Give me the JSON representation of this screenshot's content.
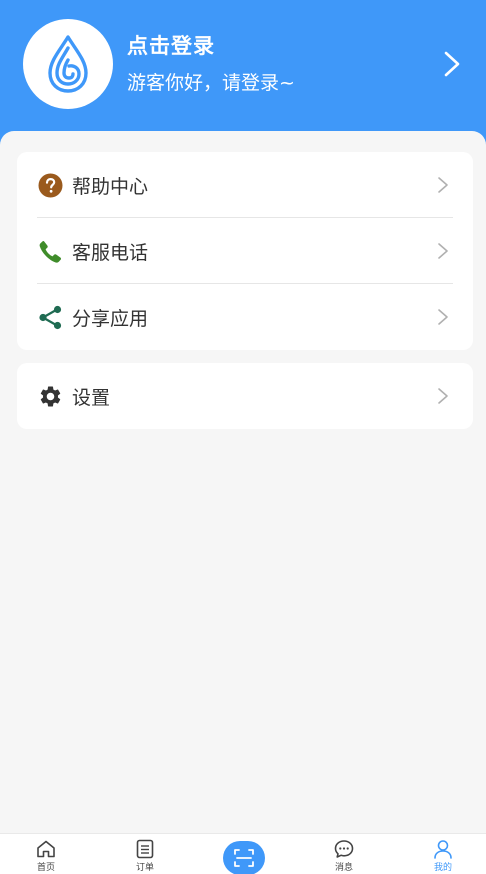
{
  "colors": {
    "accent": "#3f98f9",
    "help_icon": "#9a5a1d",
    "phone_icon": "#3f8c2a",
    "share_icon": "#1f6b52",
    "gear_icon": "#333333"
  },
  "header": {
    "title": "点击登录",
    "subtitle": "游客你好，请登录~",
    "logo_icon": "water-drop-logo",
    "chevron_icon": "chevron-right-icon"
  },
  "menu_group_1": [
    {
      "label": "帮助中心",
      "icon": "help-icon"
    },
    {
      "label": "客服电话",
      "icon": "phone-icon"
    },
    {
      "label": "分享应用",
      "icon": "share-icon"
    }
  ],
  "menu_group_2": [
    {
      "label": "设置",
      "icon": "gear-icon"
    }
  ],
  "tabbar": {
    "items": [
      {
        "label": "首页",
        "icon": "home-icon",
        "active": false
      },
      {
        "label": "订单",
        "icon": "order-list-icon",
        "active": false
      },
      {
        "label": "",
        "icon": "scan-icon",
        "active": false
      },
      {
        "label": "消息",
        "icon": "message-icon",
        "active": false
      },
      {
        "label": "我的",
        "icon": "user-icon",
        "active": true
      }
    ]
  }
}
